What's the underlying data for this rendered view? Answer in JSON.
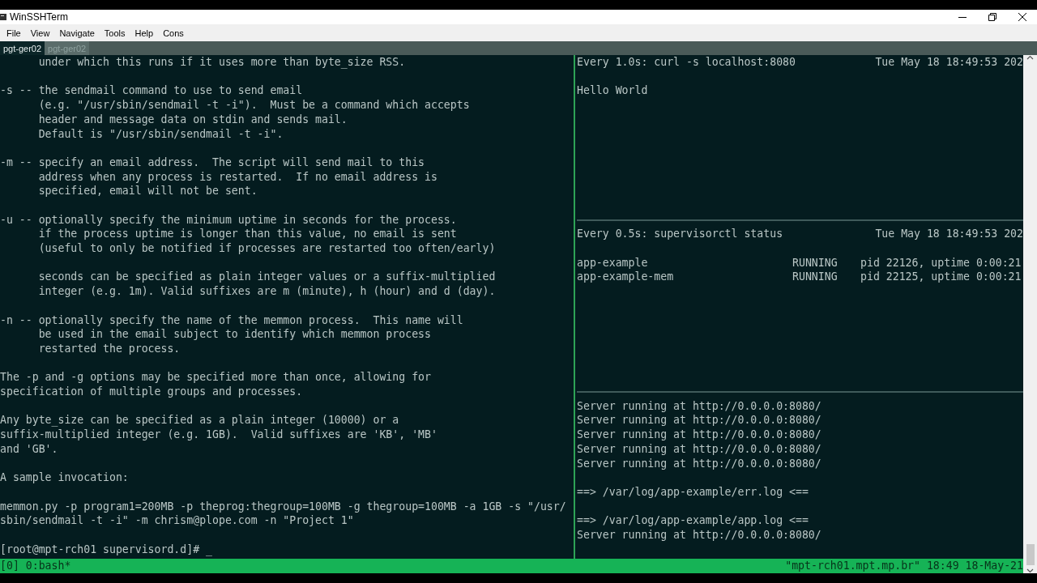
{
  "window": {
    "title": "WinSSHTerm"
  },
  "menu": [
    "File",
    "View",
    "Navigate",
    "Tools",
    "Help",
    "Cons"
  ],
  "tabs": [
    {
      "label": "pgt-ger02",
      "selected": true
    },
    {
      "label": "pgt-ger02",
      "selected": false
    }
  ],
  "left_pane": {
    "active": true,
    "paragraphs": [
      [
        "      under which this runs if it uses more than byte_size RSS."
      ],
      [
        "-s -- the sendmail command to use to send email",
        "      (e.g. \"/usr/sbin/sendmail -t -i\").  Must be a command which accepts",
        "      header and message data on stdin and sends mail.",
        "      Default is \"/usr/sbin/sendmail -t -i\"."
      ],
      [
        "-m -- specify an email address.  The script will send mail to this",
        "      address when any process is restarted.  If no email address is",
        "      specified, email will not be sent."
      ],
      [
        "-u -- optionally specify the minimum uptime in seconds for the process.",
        "      if the process uptime is longer than this value, no email is sent",
        "      (useful to only be notified if processes are restarted too often/early)"
      ],
      [
        "      seconds can be specified as plain integer values or a suffix-multiplied",
        "      integer (e.g. 1m). Valid suffixes are m (minute), h (hour) and d (day)."
      ],
      [
        "-n -- optionally specify the name of the memmon process.  This name will",
        "      be used in the email subject to identify which memmon process",
        "      restarted the process."
      ],
      [
        "The -p and -g options may be specified more than once, allowing for",
        "specification of multiple groups and processes."
      ],
      [
        "Any byte_size can be specified as a plain integer (10000) or a",
        "suffix-multiplied integer (e.g. 1GB).  Valid suffixes are 'KB', 'MB'",
        "and 'GB'."
      ],
      [
        "A sample invocation:"
      ],
      [
        "memmon.py -p program1=200MB -p theprog:thegroup=100MB -g thegroup=100MB -a 1GB -s \"/usr/",
        "sbin/sendmail -t -i\" -m chrism@plope.com -n \"Project 1\""
      ],
      [
        "[root@mpt-rch01 supervisord.d]# _"
      ]
    ]
  },
  "watch_panes": [
    {
      "kind": "output",
      "command": "Every 1.0s: curl -s localhost:8080",
      "time": "Tue May 18 18:49:53 202",
      "output": [
        "Hello World"
      ]
    },
    {
      "kind": "status",
      "command": "Every 0.5s: supervisorctl status",
      "time": "Tue May 18 18:49:53 202",
      "processes": [
        {
          "name": "app-example",
          "state": "RUNNING",
          "info": "pid 22126, uptime 0:00:21"
        },
        {
          "name": "app-example-mem",
          "state": "RUNNING",
          "info": "pid 22125, uptime 0:00:21"
        }
      ]
    }
  ],
  "log_pane": {
    "paragraphs": [
      [
        "Server running at http://0.0.0.0:8080/",
        "Server running at http://0.0.0.0:8080/",
        "Server running at http://0.0.0.0:8080/",
        "Server running at http://0.0.0.0:8080/",
        "Server running at http://0.0.0.0:8080/"
      ],
      [
        "==> /var/log/app-example/err.log <=="
      ],
      [
        "==> /var/log/app-example/app.log <==",
        "Server running at http://0.0.0.0:8080/"
      ]
    ]
  },
  "status_bar": {
    "session": "[0] 0:bash*",
    "host": "\"mpt-rch01.mpt.mp.br\" 18:49 18-May-21"
  }
}
